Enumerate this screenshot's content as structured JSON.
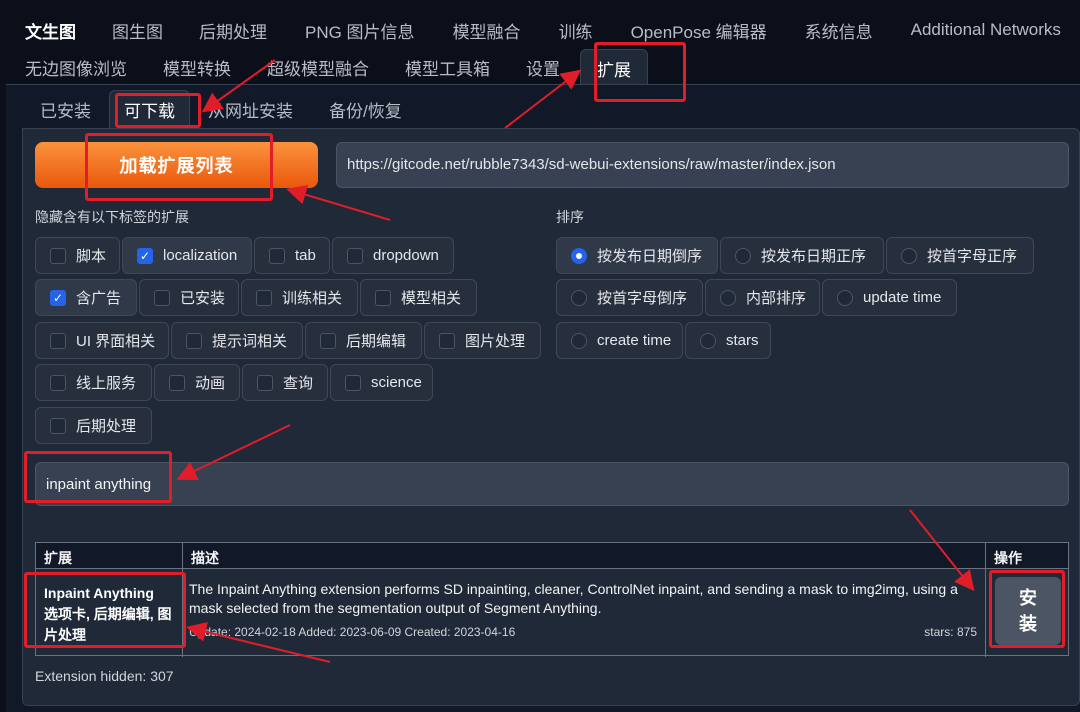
{
  "top_tabs_row1": [
    "文生图",
    "图生图",
    "后期处理",
    "PNG 图片信息",
    "模型融合",
    "训练",
    "OpenPose 编辑器",
    "系统信息",
    "Additional Networks"
  ],
  "top_tabs_row2": [
    "无边图像浏览",
    "模型转换",
    "超级模型融合",
    "模型工具箱",
    "设置",
    "扩展"
  ],
  "sub_tabs": [
    "已安装",
    "可下载",
    "从网址安装",
    "备份/恢复"
  ],
  "load_button": "加载扩展列表",
  "index_url": "https://gitcode.net/rubble7343/sd-webui-extensions/raw/master/index.json",
  "hide_label": "隐藏含有以下标签的扩展",
  "sort_label": "排序",
  "filters": [
    {
      "label": "脚本",
      "checked": false
    },
    {
      "label": "localization",
      "checked": true
    },
    {
      "label": "tab",
      "checked": false
    },
    {
      "label": "dropdown",
      "checked": false
    },
    {
      "label": "含广告",
      "checked": true
    },
    {
      "label": "已安装",
      "checked": false
    },
    {
      "label": "训练相关",
      "checked": false
    },
    {
      "label": "模型相关",
      "checked": false
    },
    {
      "label": "UI 界面相关",
      "checked": false
    },
    {
      "label": "提示词相关",
      "checked": false
    },
    {
      "label": "后期编辑",
      "checked": false
    },
    {
      "label": "图片处理",
      "checked": false
    },
    {
      "label": "线上服务",
      "checked": false
    },
    {
      "label": "动画",
      "checked": false
    },
    {
      "label": "查询",
      "checked": false
    },
    {
      "label": "science",
      "checked": false
    },
    {
      "label": "后期处理",
      "checked": false
    }
  ],
  "sort_options": [
    {
      "label": "按发布日期倒序",
      "selected": true
    },
    {
      "label": "按发布日期正序",
      "selected": false
    },
    {
      "label": "按首字母正序",
      "selected": false
    },
    {
      "label": "按首字母倒序",
      "selected": false
    },
    {
      "label": "内部排序",
      "selected": false
    },
    {
      "label": "update time",
      "selected": false
    },
    {
      "label": "create time",
      "selected": false
    },
    {
      "label": "stars",
      "selected": false
    }
  ],
  "search_value": "inpaint anything",
  "table": {
    "headers": [
      "扩展",
      "描述",
      "操作"
    ],
    "row": {
      "name": "Inpaint Anything",
      "tags": "选项卡, 后期编辑, 图片处理",
      "description": "The Inpaint Anything extension performs SD inpainting, cleaner, ControlNet inpaint, and sending a mask to img2img, using a mask selected from the segmentation output of Segment Anything.",
      "dates": "Update: 2024-02-18 Added: 2023-06-09 Created: 2023-04-16",
      "stars": "stars: 875",
      "action_line1": "安",
      "action_line2": "装"
    }
  },
  "hidden_count": "Extension hidden: 307",
  "colors": {
    "accent_orange": "#f97316",
    "annotation_red": "#e11d2a",
    "checkbox_blue": "#2563eb"
  }
}
